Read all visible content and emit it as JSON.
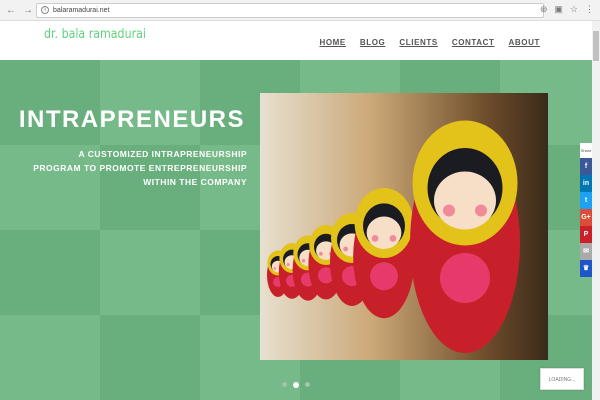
{
  "browser": {
    "url": "balaramadurai.net"
  },
  "site": {
    "logo": "dr. bala ramadurai",
    "menu": [
      "HOME",
      "BLOG",
      "CLIENTS",
      "CONTACT",
      "ABOUT"
    ]
  },
  "hero": {
    "title": "INTRAPRENEURS",
    "subtitle_lines": [
      "A CUSTOMIZED INTRAPRENEURSHIP",
      "PROGRAM TO PROMOTE ENTREPRENEURSHIP",
      "WITHIN THE COMPANY"
    ],
    "slide_active": 2,
    "slide_count": 3,
    "image": "matryoshka-dolls"
  },
  "share": {
    "label": "Share",
    "buttons": [
      {
        "icon": "facebook-icon",
        "glyph": "f",
        "color": "#3b5998"
      },
      {
        "icon": "linkedin-icon",
        "glyph": "in",
        "color": "#0077b5"
      },
      {
        "icon": "twitter-icon",
        "glyph": "t",
        "color": "#1da1f2"
      },
      {
        "icon": "googleplus-icon",
        "glyph": "G+",
        "color": "#dd4b39"
      },
      {
        "icon": "pinterest-icon",
        "glyph": "P",
        "color": "#cb2027"
      },
      {
        "icon": "email-icon",
        "glyph": "✉",
        "color": "#aaaaaa"
      },
      {
        "icon": "sumo-icon",
        "glyph": "♛",
        "color": "#1e55c9"
      }
    ]
  },
  "loading": "LOADING..."
}
